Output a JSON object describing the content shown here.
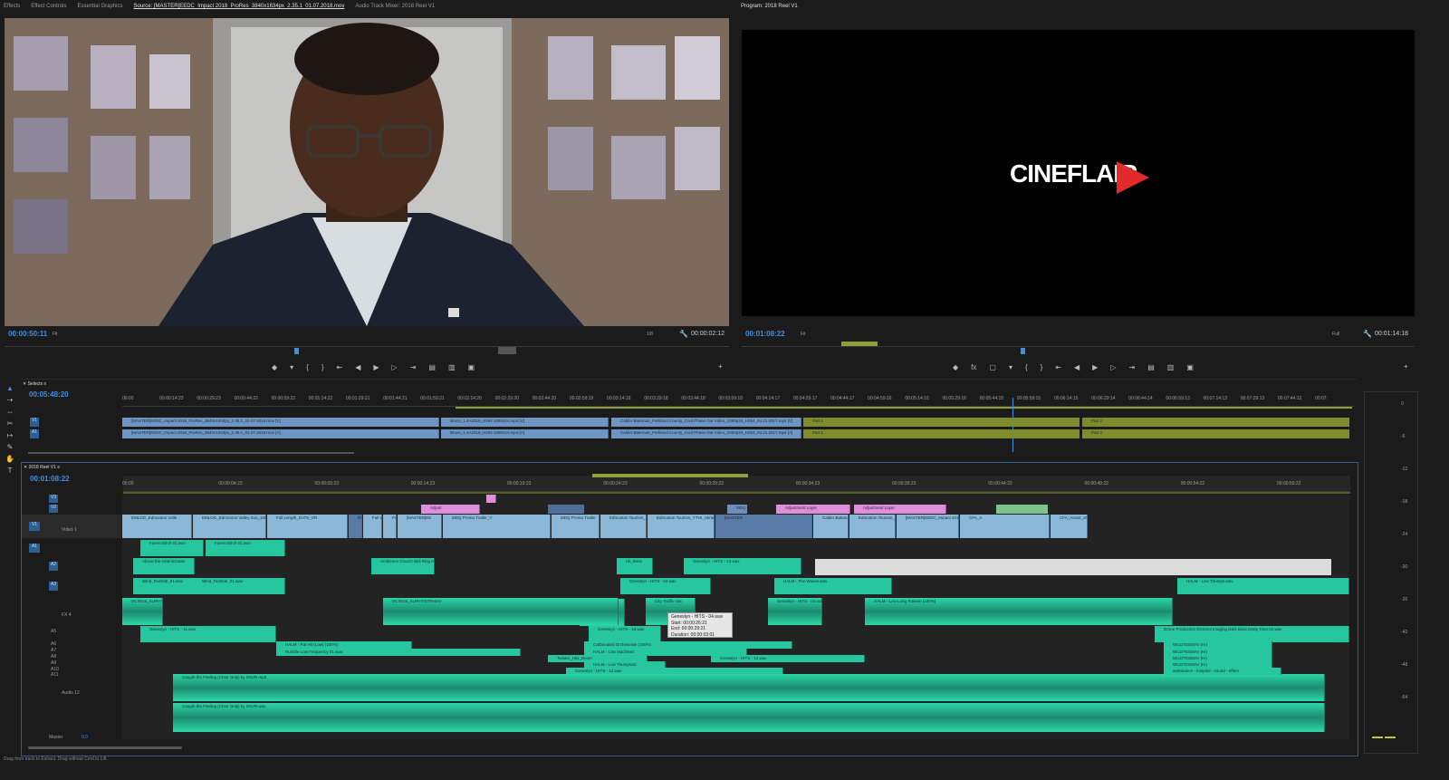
{
  "source_panel": {
    "tabs": [
      "Effects",
      "Effect Controls",
      "Essential Graphics",
      "Source: [MASTER]EEDC_Impact 2018_ProRes_3840x1634px_2.35.1_01.07.2018.mov",
      "Audio Track Mixer: 2018 Reel V1"
    ],
    "active_tab": 3,
    "timecode": "00:00:50:11",
    "fit": "Fit",
    "resolution": "1/8",
    "duration": "00:00:02:12"
  },
  "program_panel": {
    "title": "Program: 2018 Reel V1",
    "timecode": "00:01:08:22",
    "fit": "Fit",
    "resolution": "Full",
    "duration": "00:01:14:18",
    "logo": "CINEFLAIR"
  },
  "selects_timeline": {
    "name": "Selects",
    "timecode": "00:05:48:20",
    "ruler": [
      "00:00",
      "00:00:14:23",
      "00:00:29:23",
      "00:00:44:22",
      "00:00:59:22",
      "00:01:14:22",
      "00:01:29:21",
      "00:01:44:21",
      "00:01:59:21",
      "00:02:14:20",
      "00:02:29:20",
      "00:02:44:20",
      "00:02:59:19",
      "00:03:14:19",
      "00:03:29:18",
      "00:03:44:18",
      "00:03:59:18",
      "00:04:14:17",
      "00:04:29:17",
      "00:04:44:17",
      "00:04:59:16",
      "00:05:14:16",
      "00:05:29:16",
      "00:05:44:15",
      "00:05:59:15",
      "00:06:14:15",
      "00:06:29:14",
      "00:06:44:14",
      "00:06:59:13",
      "00:07:14:13",
      "00:07:29:13",
      "00:07:44:12",
      "00:07:"
    ],
    "tracks": [
      "V1",
      "A1"
    ],
    "clips_v": [
      "[MASTER]EEDC_Impact 2018_ProRes_3840x1634px_2.35.1_01.07.2018.mov [V]",
      "Bruce_1.4A2018_H264.1080x24.mp4 [V]",
      "Calder Bateman_Parkland County_Cool Phase Out Video_1080p24_H264_04.21.2017.mp4 [V]",
      "Part 1",
      "Part 2"
    ],
    "clips_a": [
      "[MASTER]EEDC_Impact 2018_ProRes_3840x1634px_2.35.1_01.07.2018.mov [A]",
      "Bruce_1.4A2018_H264.1080x24.mp4 [A]",
      "Calder Bateman_Parkland County_Cool Phase Out Video_1080p24_H264_04.21.2017.mp4 [A]",
      "Part 1",
      "Part 2"
    ]
  },
  "reel_timeline": {
    "name": "2018 Reel V1",
    "timecode": "00:01:08:22",
    "ruler": [
      "00:00",
      "00:00:04:23",
      "00:00:09:23",
      "00:00:14:23",
      "00:00:19:23",
      "00:00:24:23",
      "00:00:29:23",
      "00:00:34:23",
      "00:00:39:23",
      "00:00:44:22",
      "00:00:49:22",
      "00:00:54:22",
      "00:00:59:22"
    ],
    "track_labels": [
      "V3",
      "V2",
      "V1",
      "Video 1",
      "A1",
      "A2",
      "A3",
      "FX 4",
      "A5",
      "A6",
      "A7",
      "A8",
      "A9",
      "A10",
      "A11",
      "Audio 12",
      "Master"
    ],
    "master_value": "0.0",
    "video_clips": [
      "EMLOG_Edmonton Valle",
      "EMLOG_Edmonton Valley Zoo_1080p24_H2",
      "Full Length_DAT8_OR",
      "EMLG",
      "Full Le",
      "Full",
      "[MASTER]EE",
      "MDQ Promo Trailer_V",
      "MDQ Promo Trailer",
      "Edmonton Tourism_Street",
      "Edmonton Tourism_YTHI_Ukrainian Cultural He",
      "[MASTER",
      "Calder Bateman_Parkl",
      "Edmonton Tourism_Murals_Uncm_Hi",
      "[MASTER]EEDC_Impact 2018_ProR",
      "CFA_A",
      "CFA_Assist_1920x9x"
    ],
    "v2_clips": [
      "Adjustment Layer",
      "Adjustment Layer",
      "Adjust",
      "Mo",
      "MDQ"
    ],
    "audio_clips": [
      "Forest Birch 01.wav",
      "Forest Birch 01.wav",
      "Above the Asteroid.wav",
      "Wind_Rumble_01.wav",
      "Wind_Rumble_01.wav",
      "Ambience Church Bell Ring Hi",
      "Genesis",
      "Hit_Bass",
      "Geneslyn - HITS - 13.wav",
      "Geneslyn - HITS - 04.wav",
      "HALM - The Waves.wav",
      "HALM - Low Thumps.wav",
      "DCX018_ALIRHTSTR",
      "DCX018_ALIRHTSTRHIAV",
      "City Traffic Out",
      "Geneslyn - HITS - 04.wav",
      "HALM - Low Long Tsalase (100%)",
      "Geneslyn - HITS - 11.wav",
      "Geneslyn - HITS - 10.wav",
      "Drone Production Element Imaging Dark Bass Deep Tone 01.wav",
      "HALM - Pat Hit (Low) (100%)",
      "Rumble Low Frequency 01.wav",
      "Carbonated Orchestrate (100%)",
      "HALM - Low Machines",
      "Twister_Hits_Boom",
      "Geneslyn - HITS - 12.wav",
      "HALM - Low Thumpsaic",
      "Geneslyn - HITS - 12.wav",
      "Caught the Feeling (Choir Only) by SNVR.mp3",
      "Caught the Feeling (Choir Only) by SNVR.wav",
      "WILDTESMAV (Hi)",
      "WILDTESMAV (Hi)",
      "WILDTESMAV (Hi)",
      "WILDTESMAV (Hi)",
      "ambulance - hospital - sound - effect"
    ],
    "tooltip": {
      "name": "Geneslyn - HITS - 04.wav",
      "start": "Start: 00:00:26:21",
      "end": "End: 00:00:29:21",
      "duration": "Duration: 00:00:03:01"
    }
  },
  "meter_scale": [
    "0",
    "-6",
    "-12",
    "-18",
    "-24",
    "-30",
    "-36",
    "-42",
    "-48",
    "-54"
  ],
  "status_bar": "Drag from track to Extract. Drag without Cmd to Lift."
}
